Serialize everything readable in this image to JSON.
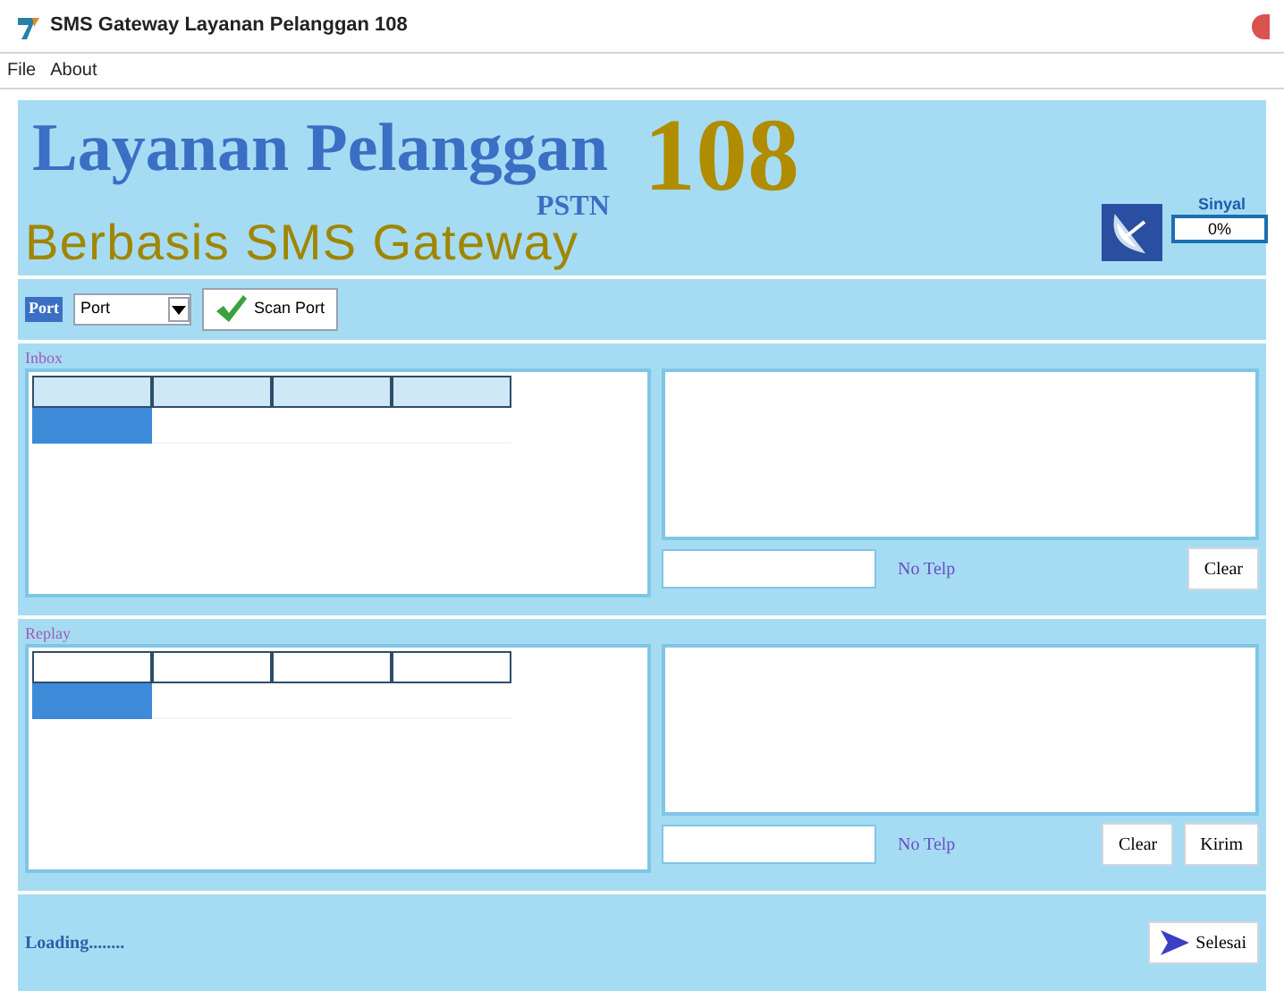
{
  "window": {
    "title": "SMS Gateway Layanan Pelanggan 108"
  },
  "menu": [
    {
      "label": "File"
    },
    {
      "label": "About"
    }
  ],
  "banner": {
    "title": "Layanan Pelanggan",
    "number": "108",
    "subtitle": "PSTN",
    "tagline": "Berbasis SMS Gateway",
    "signal_label": "Sinyal",
    "signal_value": "0%"
  },
  "port_bar": {
    "label": "Port",
    "port_select": "Port",
    "scan_button": "Scan Port"
  },
  "sections": [
    {
      "title": "Inbox",
      "first_row": [
        {
          "selected": true
        },
        {
          "selected": false
        },
        {
          "selected": false
        },
        {
          "selected": false
        }
      ],
      "phone_label": "No Telp",
      "buttons": [
        "Clear"
      ]
    },
    {
      "title": "Replay",
      "first_row": [
        {
          "selected": true
        },
        {
          "selected": false
        },
        {
          "selected": false
        },
        {
          "selected": false
        }
      ],
      "phone_label": "No Telp",
      "buttons": [
        "Clear",
        "Kirim"
      ]
    }
  ],
  "status_bar": {
    "text": "Loading........",
    "button": "Selesai"
  }
}
